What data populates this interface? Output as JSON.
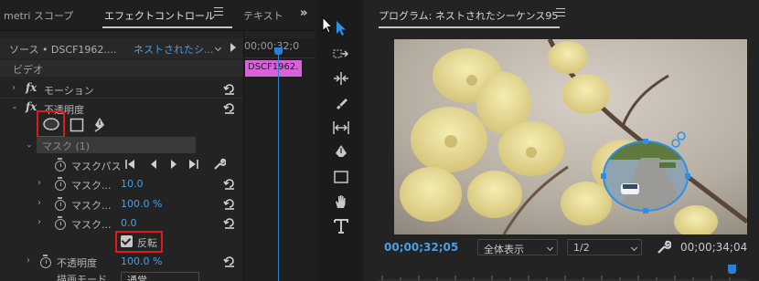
{
  "left_panel": {
    "tabs": [
      {
        "label": "metri スコープ",
        "active": false
      },
      {
        "label": "エフェクトコントロール",
        "active": true
      },
      {
        "label": "テキスト",
        "active": false
      }
    ],
    "source_label": "ソース • DSCF1962....",
    "sequence_label": "ネストされたシ...",
    "section_video": "ビデオ",
    "effects": {
      "motion": "モーション",
      "opacity": "不透明度"
    },
    "mask": {
      "section_label": "マスク (1)",
      "path_label": "マスクパス",
      "properties": [
        {
          "label": "マスク...",
          "value": "10.0"
        },
        {
          "label": "マスク...",
          "value": "100.0 %"
        },
        {
          "label": "マスク...",
          "value": "0.0"
        }
      ],
      "invert_label": "反転",
      "invert_checked": true
    },
    "opacity_row": {
      "label": "不透明度",
      "value": "100.0 %"
    },
    "blend_mode": {
      "label": "描画モード",
      "value": "通常"
    }
  },
  "timeline": {
    "timecode": "00;00;32;0",
    "clip_label": "DSCF1962."
  },
  "tools": [
    "selection-tool",
    "track-select-tool",
    "ripple-edit-tool",
    "razor-tool",
    "slip-tool",
    "pen-tool",
    "rectangle-tool",
    "hand-tool",
    "type-tool"
  ],
  "program": {
    "title": "プログラム: ネストされたシーケンス95",
    "timecode_current": "00;00;32;05",
    "fit_option": "全体表示",
    "resolution": "1/2",
    "timecode_total": "00;00;34;04"
  },
  "colors": {
    "accent_blue": "#4a9fe6",
    "highlight_red": "#e01a1a",
    "clip_pink": "#d664d8"
  }
}
